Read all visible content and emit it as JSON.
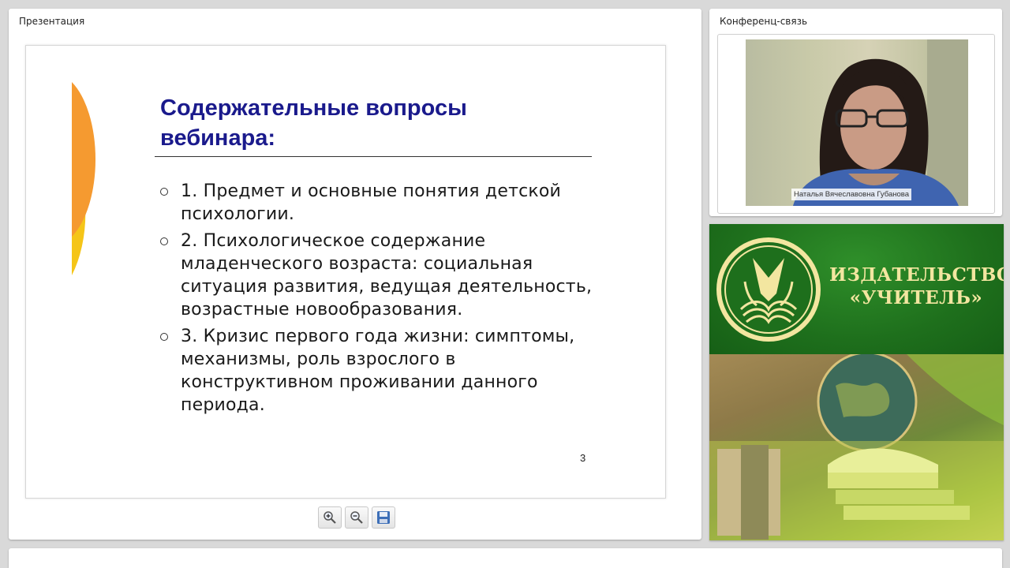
{
  "presentation": {
    "title": "Презентация",
    "slide": {
      "title": "Содержательные вопросы вебинара:",
      "bullets": [
        "1. Предмет и основные понятия детской психологии.",
        "2. Психологическое содержание младенческого возраста: социальная ситуация развития, ведущая деятельность, возрастные новообразования.",
        "3. Кризис первого года жизни: симптомы, механизмы, роль взрослого в конструктивном проживании данного периода."
      ],
      "page_number": "3"
    },
    "tools": [
      {
        "icon": "zoom-in-icon"
      },
      {
        "icon": "zoom-out-icon"
      },
      {
        "icon": "save-icon"
      }
    ]
  },
  "conference": {
    "title": "Конференц-связь",
    "participant_name": "Наталья Вячеславовна Губанова"
  },
  "publisher": {
    "name_line1": "ИЗДАТЕЛЬСТВО",
    "name_line2": "«УЧИТЕЛЬ»",
    "colors": {
      "green": "#1e6f1c",
      "gold": "#f3e6a0"
    }
  }
}
